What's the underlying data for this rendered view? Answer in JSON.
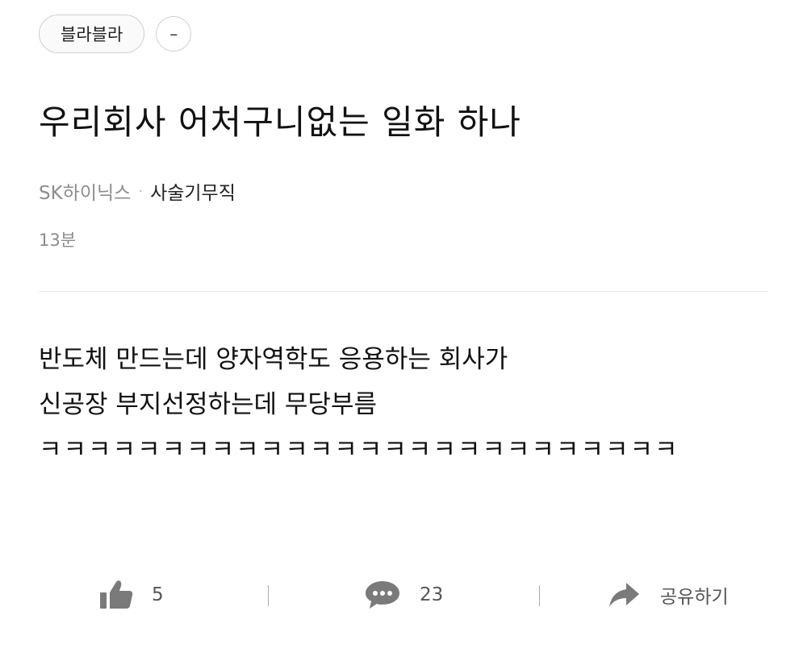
{
  "tag": {
    "label": "블라블라"
  },
  "more_button": {
    "label": "–"
  },
  "post": {
    "title": "우리회사 어처구니없는 일화 하나",
    "company": "SK하이닉스",
    "separator": "·",
    "job": "사술기무직",
    "time": "13분",
    "body_lines": [
      "반도체 만드는데 양자역학도 응용하는 회사가",
      "신공장 부지선정하는데 무당부름",
      "ㅋㅋㅋㅋㅋㅋㅋㅋㅋㅋㅋㅋㅋㅋㅋㅋㅋㅋㅋㅋㅋㅋㅋㅋㅋㅋ"
    ]
  },
  "actions": {
    "like": {
      "icon": "thumbs-up-icon",
      "count": "5"
    },
    "comment": {
      "icon": "speech-bubble-icon",
      "count": "23"
    },
    "share": {
      "icon": "share-arrow-icon",
      "label": "공유하기"
    }
  },
  "colors": {
    "text_primary": "#111111",
    "text_secondary": "#8c8c8c",
    "icon_gray": "#7a7a7a",
    "border": "#cfcfcf"
  }
}
